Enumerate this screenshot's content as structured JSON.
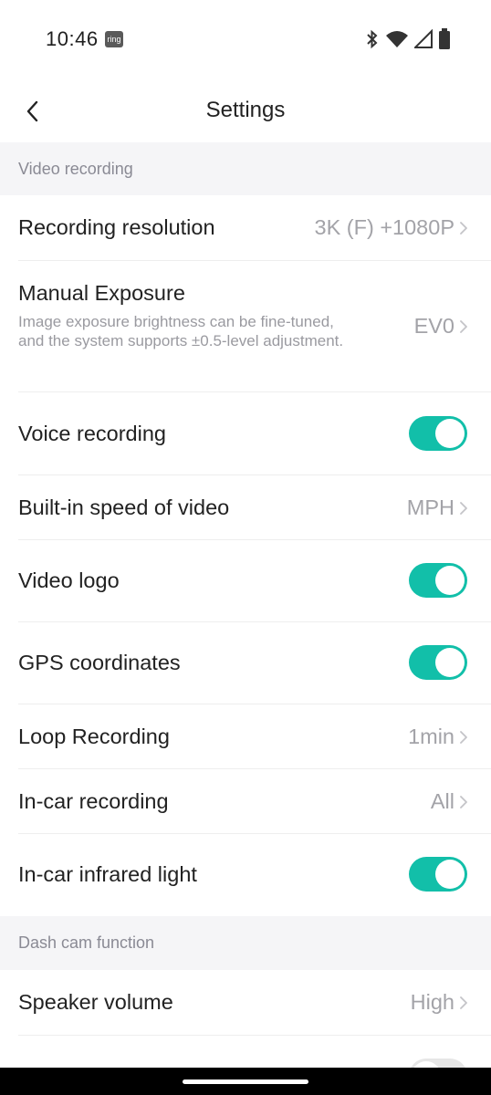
{
  "status_bar": {
    "time": "10:46",
    "ring_badge": "ring",
    "icons": [
      "bluetooth-icon",
      "wifi-icon",
      "cell-signal-icon",
      "battery-icon"
    ]
  },
  "header": {
    "title": "Settings",
    "back_icon": "chevron-left-icon"
  },
  "sections": {
    "video_recording": "Video recording",
    "dash_cam_function": "Dash cam function"
  },
  "rows": {
    "recording_resolution": {
      "label": "Recording resolution",
      "value": "3K (F) +1080P"
    },
    "manual_exposure": {
      "label": "Manual Exposure",
      "description": "Image exposure brightness can be fine-tuned, and the system supports ±0.5-level adjustment.",
      "value": "EV0"
    },
    "voice_recording": {
      "label": "Voice recording",
      "enabled": true
    },
    "builtin_speed": {
      "label": "Built-in speed of video",
      "value": "MPH"
    },
    "video_logo": {
      "label": "Video logo",
      "enabled": true
    },
    "gps_coordinates": {
      "label": "GPS coordinates",
      "enabled": true
    },
    "loop_recording": {
      "label": "Loop Recording",
      "value": "1min"
    },
    "in_car_recording": {
      "label": "In-car recording",
      "value": "All"
    },
    "in_car_infrared": {
      "label": "In-car infrared light",
      "enabled": true
    },
    "speaker_volume": {
      "label": "Speaker volume",
      "value": "High"
    },
    "next_item": {
      "label": "",
      "enabled": false
    }
  },
  "colors": {
    "accent": "#12bfa9",
    "section_bg": "#f5f5f7",
    "value_text": "#a3a3a8"
  }
}
